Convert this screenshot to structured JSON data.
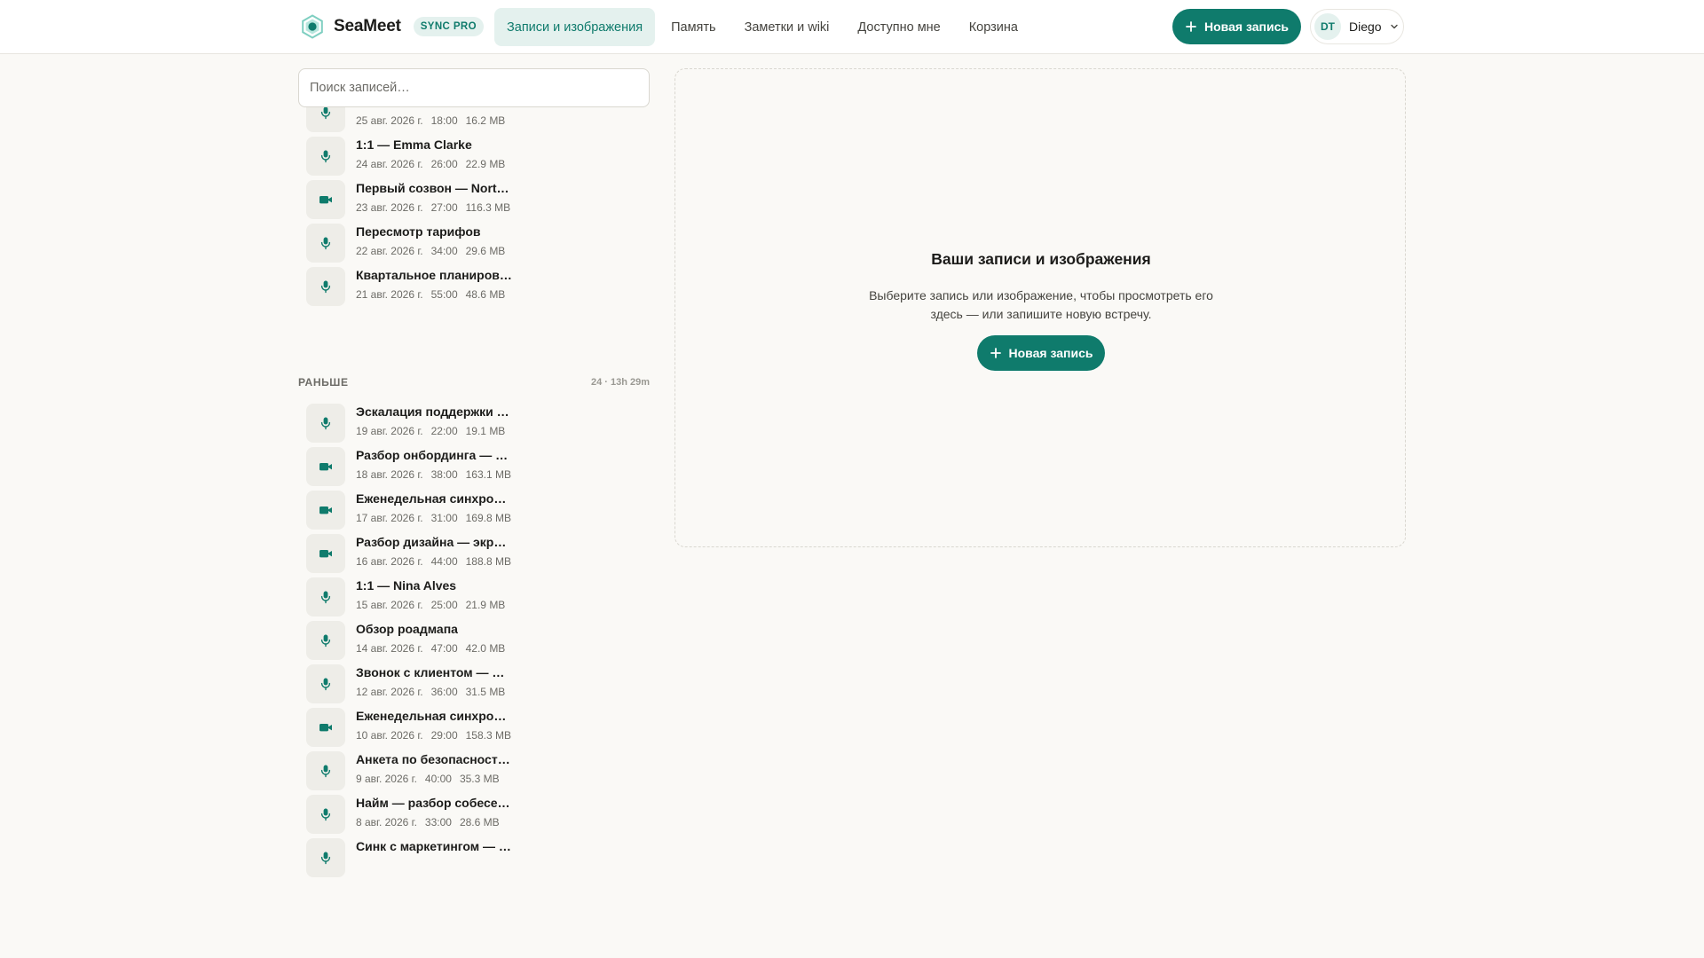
{
  "header": {
    "brand_name": "SeaMeet",
    "plan_badge": "SYNC PRO",
    "nav_tabs": [
      {
        "label": "Записи и изображения",
        "active": true
      },
      {
        "label": "Память",
        "active": false
      },
      {
        "label": "Заметки и wiki",
        "active": false
      },
      {
        "label": "Доступно мне",
        "active": false
      },
      {
        "label": "Корзина",
        "active": false
      }
    ],
    "new_record_label": "Новая запись",
    "user": {
      "initials": "DT",
      "name": "Diego"
    }
  },
  "search": {
    "placeholder": "Поиск записей…",
    "value": ""
  },
  "recent_items": [
    {
      "title": "",
      "date": "25 авг. 2026 г.",
      "duration": "18:00",
      "size": "16.2 MB",
      "kind": "audio"
    },
    {
      "title": "1:1 — Emma Clarke",
      "date": "24 авг. 2026 г.",
      "duration": "26:00",
      "size": "22.9 MB",
      "kind": "audio"
    },
    {
      "title": "Первый созвон — Nort…",
      "date": "23 авг. 2026 г.",
      "duration": "27:00",
      "size": "116.3 MB",
      "kind": "video"
    },
    {
      "title": "Пересмотр тарифов",
      "date": "22 авг. 2026 г.",
      "duration": "34:00",
      "size": "29.6 MB",
      "kind": "audio"
    },
    {
      "title": "Квартальное планиров…",
      "date": "21 авг. 2026 г.",
      "duration": "55:00",
      "size": "48.6 MB",
      "kind": "audio"
    }
  ],
  "earlier_section": {
    "label": "РАНЬШЕ",
    "stats": "24 · 13h 29m",
    "items": [
      {
        "title": "Эскалация поддержки …",
        "date": "19 авг. 2026 г.",
        "duration": "22:00",
        "size": "19.1 MB",
        "kind": "audio"
      },
      {
        "title": "Разбор онбординга — …",
        "date": "18 авг. 2026 г.",
        "duration": "38:00",
        "size": "163.1 MB",
        "kind": "video"
      },
      {
        "title": "Еженедельная синхро…",
        "date": "17 авг. 2026 г.",
        "duration": "31:00",
        "size": "169.8 MB",
        "kind": "video"
      },
      {
        "title": "Разбор дизайна — экр…",
        "date": "16 авг. 2026 г.",
        "duration": "44:00",
        "size": "188.8 MB",
        "kind": "video"
      },
      {
        "title": "1:1 — Nina Alves",
        "date": "15 авг. 2026 г.",
        "duration": "25:00",
        "size": "21.9 MB",
        "kind": "audio"
      },
      {
        "title": "Обзор роадмапа",
        "date": "14 авг. 2026 г.",
        "duration": "47:00",
        "size": "42.0 MB",
        "kind": "audio"
      },
      {
        "title": "Звонок с клиентом — …",
        "date": "12 авг. 2026 г.",
        "duration": "36:00",
        "size": "31.5 MB",
        "kind": "audio"
      },
      {
        "title": "Еженедельная синхро…",
        "date": "10 авг. 2026 г.",
        "duration": "29:00",
        "size": "158.3 MB",
        "kind": "video"
      },
      {
        "title": "Анкета по безопасност…",
        "date": "9 авг. 2026 г.",
        "duration": "40:00",
        "size": "35.3 MB",
        "kind": "audio"
      },
      {
        "title": "Найм — разбор собесе…",
        "date": "8 авг. 2026 г.",
        "duration": "33:00",
        "size": "28.6 MB",
        "kind": "audio"
      },
      {
        "title": "Синк с маркетингом — …",
        "date": "",
        "duration": "",
        "size": "",
        "kind": "audio"
      }
    ]
  },
  "empty_state": {
    "title": "Ваши записи и изображения",
    "description": "Выберите запись или изображение, чтобы просмотреть его здесь — или запишите новую встречу.",
    "button_label": "Новая запись"
  },
  "colors": {
    "accent": "#0f7b6c",
    "accent_soft": "#e4f1ee",
    "background": "#faf9f6",
    "icon_tile": "#eeede8"
  },
  "icons": {
    "audio": "microphone-icon",
    "video": "video-camera-icon",
    "add": "plus-icon",
    "dropdown": "chevron-down-icon",
    "logo": "seameet-logo"
  }
}
